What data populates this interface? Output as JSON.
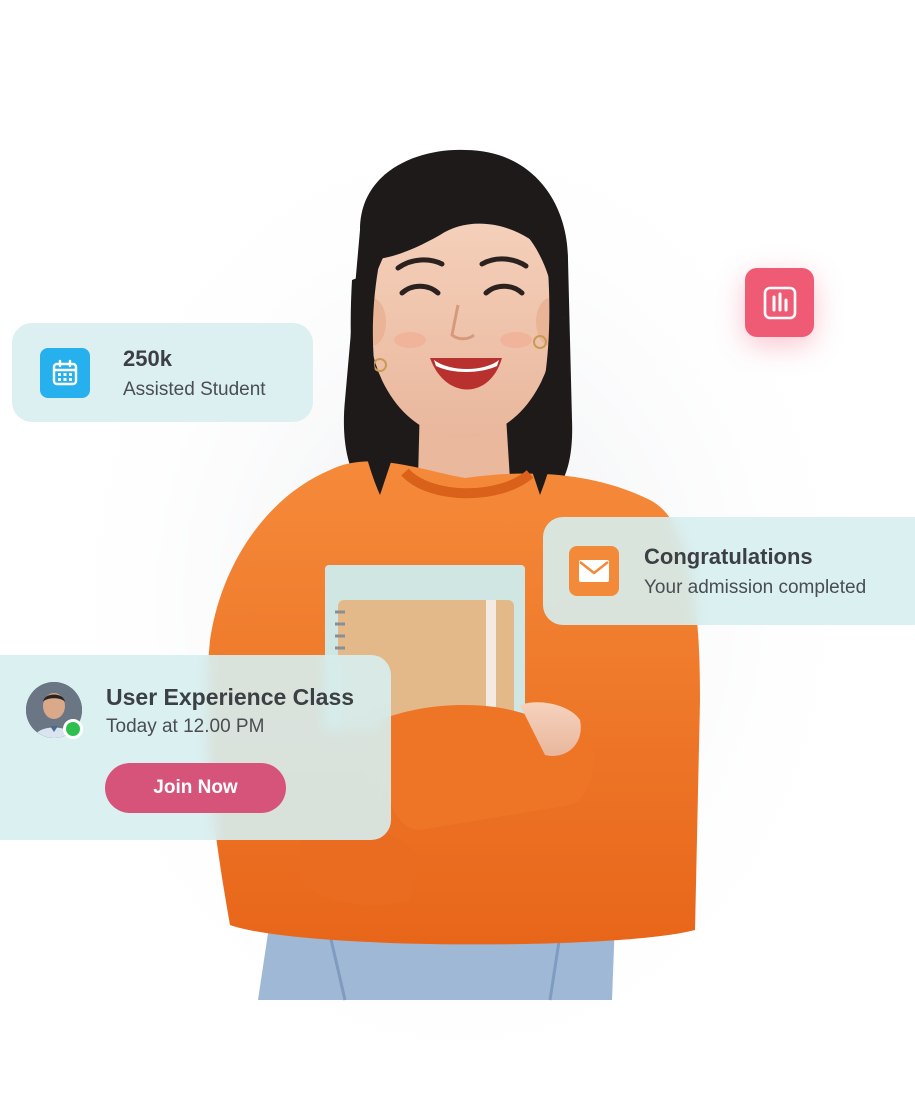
{
  "stats_card": {
    "icon": "calendar-icon",
    "value": "250k",
    "label": "Assisted Student"
  },
  "admission_card": {
    "icon": "mail-icon",
    "title": "Congratulations",
    "subtitle": "Your admission completed"
  },
  "class_card": {
    "avatar": "instructor-avatar",
    "status": "online",
    "title": "User Experience Class",
    "time": "Today at 12.00 PM",
    "join_label": "Join Now"
  },
  "chart_badge": {
    "icon": "bar-chart-icon"
  },
  "colors": {
    "card_bg": "#d6eef0",
    "calendar_blue": "#27b0ee",
    "mail_orange": "#f28a3a",
    "button_pink": "#d6537a",
    "badge_pink": "#ef5a75",
    "online_green": "#2fbf4f",
    "sweater_orange": "#f37420"
  }
}
